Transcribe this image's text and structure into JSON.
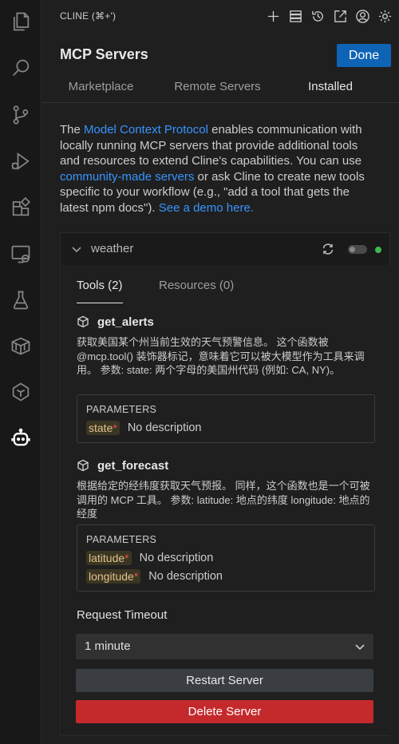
{
  "window": {
    "title": "CLINE (⌘+')"
  },
  "activity_bar": {
    "items": [
      {
        "name": "explorer",
        "icon": "files-icon"
      },
      {
        "name": "search",
        "icon": "search-icon"
      },
      {
        "name": "source-control",
        "icon": "source-control-icon"
      },
      {
        "name": "run-debug",
        "icon": "run-debug-icon"
      },
      {
        "name": "extensions",
        "icon": "extensions-icon"
      },
      {
        "name": "remote-explorer",
        "icon": "remote-explorer-icon"
      },
      {
        "name": "testing",
        "icon": "flask-icon"
      },
      {
        "name": "containers",
        "icon": "box-icon"
      },
      {
        "name": "gitlens",
        "icon": "gitlens-icon"
      },
      {
        "name": "cline",
        "icon": "robot-icon",
        "active": true
      }
    ]
  },
  "toolbar_icons": [
    "plus-icon",
    "server-stack-icon",
    "history-icon",
    "popout-icon",
    "account-icon",
    "gear-icon"
  ],
  "header": {
    "title": "MCP Servers",
    "done_label": "Done"
  },
  "tabs": [
    {
      "label": "Marketplace"
    },
    {
      "label": "Remote Servers"
    },
    {
      "label": "Installed",
      "active": true
    }
  ],
  "intro": {
    "part1": "The ",
    "link1": "Model Context Protocol",
    "part2": " enables communication with locally running MCP servers that provide additional tools and resources to extend Cline's capabilities. You can use ",
    "link2": "community-made servers",
    "part3": " or ask Cline to create new tools specific to your workflow (e.g., \"add a tool that gets the latest npm docs\"). ",
    "link3": "See a demo here."
  },
  "server": {
    "name": "weather",
    "status": "connected",
    "status_color": "#3fb950",
    "subtabs": [
      {
        "label": "Tools (2)",
        "active": true
      },
      {
        "label": "Resources (0)"
      }
    ],
    "tools": [
      {
        "name": "get_alerts",
        "description": "获取美国某个州当前生效的天气预警信息。 这个函数被 @mcp.tool() 装饰器标记，意味着它可以被大模型作为工具来调用。 参数: state: 两个字母的美国州代码 (例如: CA, NY)。",
        "params_title": "PARAMETERS",
        "params": [
          {
            "name": "state",
            "required_mark": "*",
            "desc": "No description"
          }
        ]
      },
      {
        "name": "get_forecast",
        "description": "根据给定的经纬度获取天气预报。 同样，这个函数也是一个可被调用的 MCP 工具。 参数: latitude: 地点的纬度 longitude: 地点的经度",
        "params_title": "PARAMETERS",
        "params": [
          {
            "name": "latitude",
            "required_mark": "*",
            "desc": "No description"
          },
          {
            "name": "longitude",
            "required_mark": "*",
            "desc": "No description"
          }
        ]
      }
    ],
    "timeout_label": "Request Timeout",
    "timeout_value": "1 minute",
    "restart_label": "Restart Server",
    "delete_label": "Delete Server"
  },
  "colors": {
    "accent": "#0e63b5",
    "link": "#3794ff",
    "danger": "#c4292c",
    "param_text": "#e2c08d"
  }
}
